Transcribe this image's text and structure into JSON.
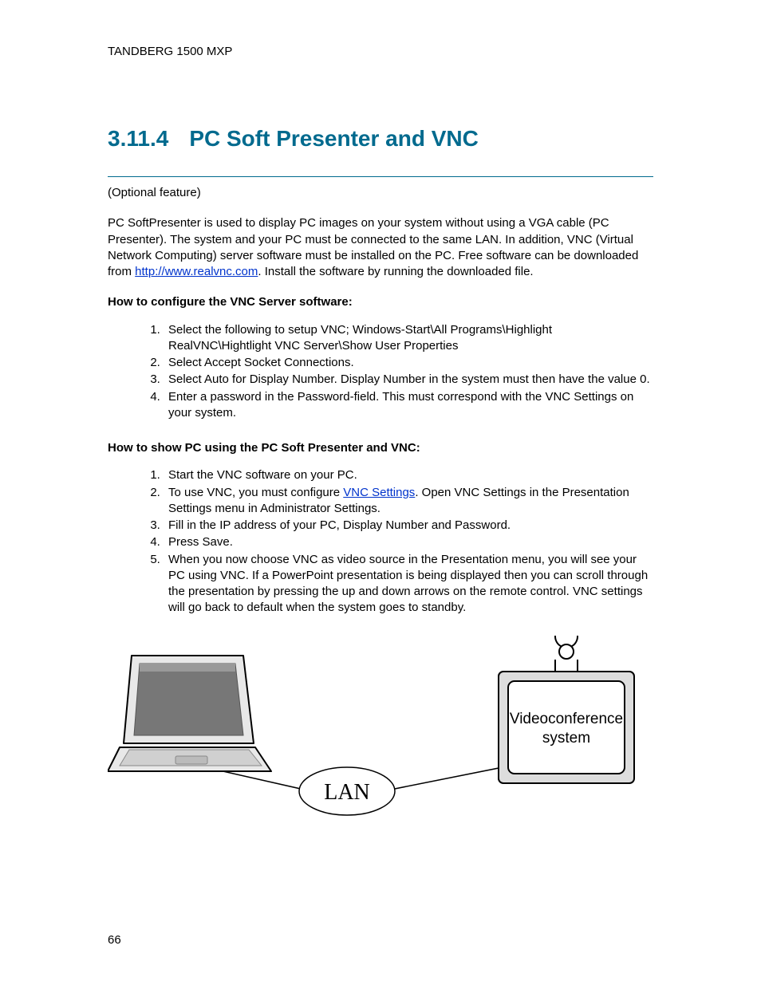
{
  "header": "TANDBERG 1500 MXP",
  "title_num": "3.11.4",
  "title_text": "PC Soft Presenter and VNC",
  "optional": "(Optional feature)",
  "intro_a": "PC SoftPresenter is used to display PC images on your system without using a VGA cable (PC Presenter). The system and your PC must be connected to the same LAN. In addition, VNC (Virtual Network Computing) server software must be installed on the PC. Free software can be downloaded from ",
  "intro_link": "http://www.realvnc.com",
  "intro_b": ". Install the software by running the downloaded file.",
  "sub1": "How to configure the VNC Server software:",
  "list1": [
    "Select the following to setup VNC; Windows-Start\\All Programs\\Highlight RealVNC\\Hightlight VNC Server\\Show User Properties",
    "Select Accept Socket Connections.",
    "Select Auto for Display Number. Display Number in the system must then have the value 0.",
    "Enter a password in the Password-field. This must correspond with the VNC Settings on your system."
  ],
  "sub2": "How to show PC using the PC Soft Presenter and VNC:",
  "list2": {
    "i1": "Start the VNC software on your PC.",
    "i2a": "To use VNC, you must configure ",
    "i2link": "VNC Settings",
    "i2b": ". Open VNC Settings in the Presentation Settings menu in Administrator Settings.",
    "i3": "Fill in the IP address of your PC, Display Number and Password.",
    "i4": "Press Save.",
    "i5": "When you now choose VNC as video source in the Presentation menu, you will see your PC using VNC. If a PowerPoint presentation is being displayed then you can scroll through the presentation by pressing the up and down arrows on the remote control. VNC settings will go back to default when the system goes to standby."
  },
  "diagram": {
    "lan": "LAN",
    "vc": "Videoconference system"
  },
  "page": "66"
}
